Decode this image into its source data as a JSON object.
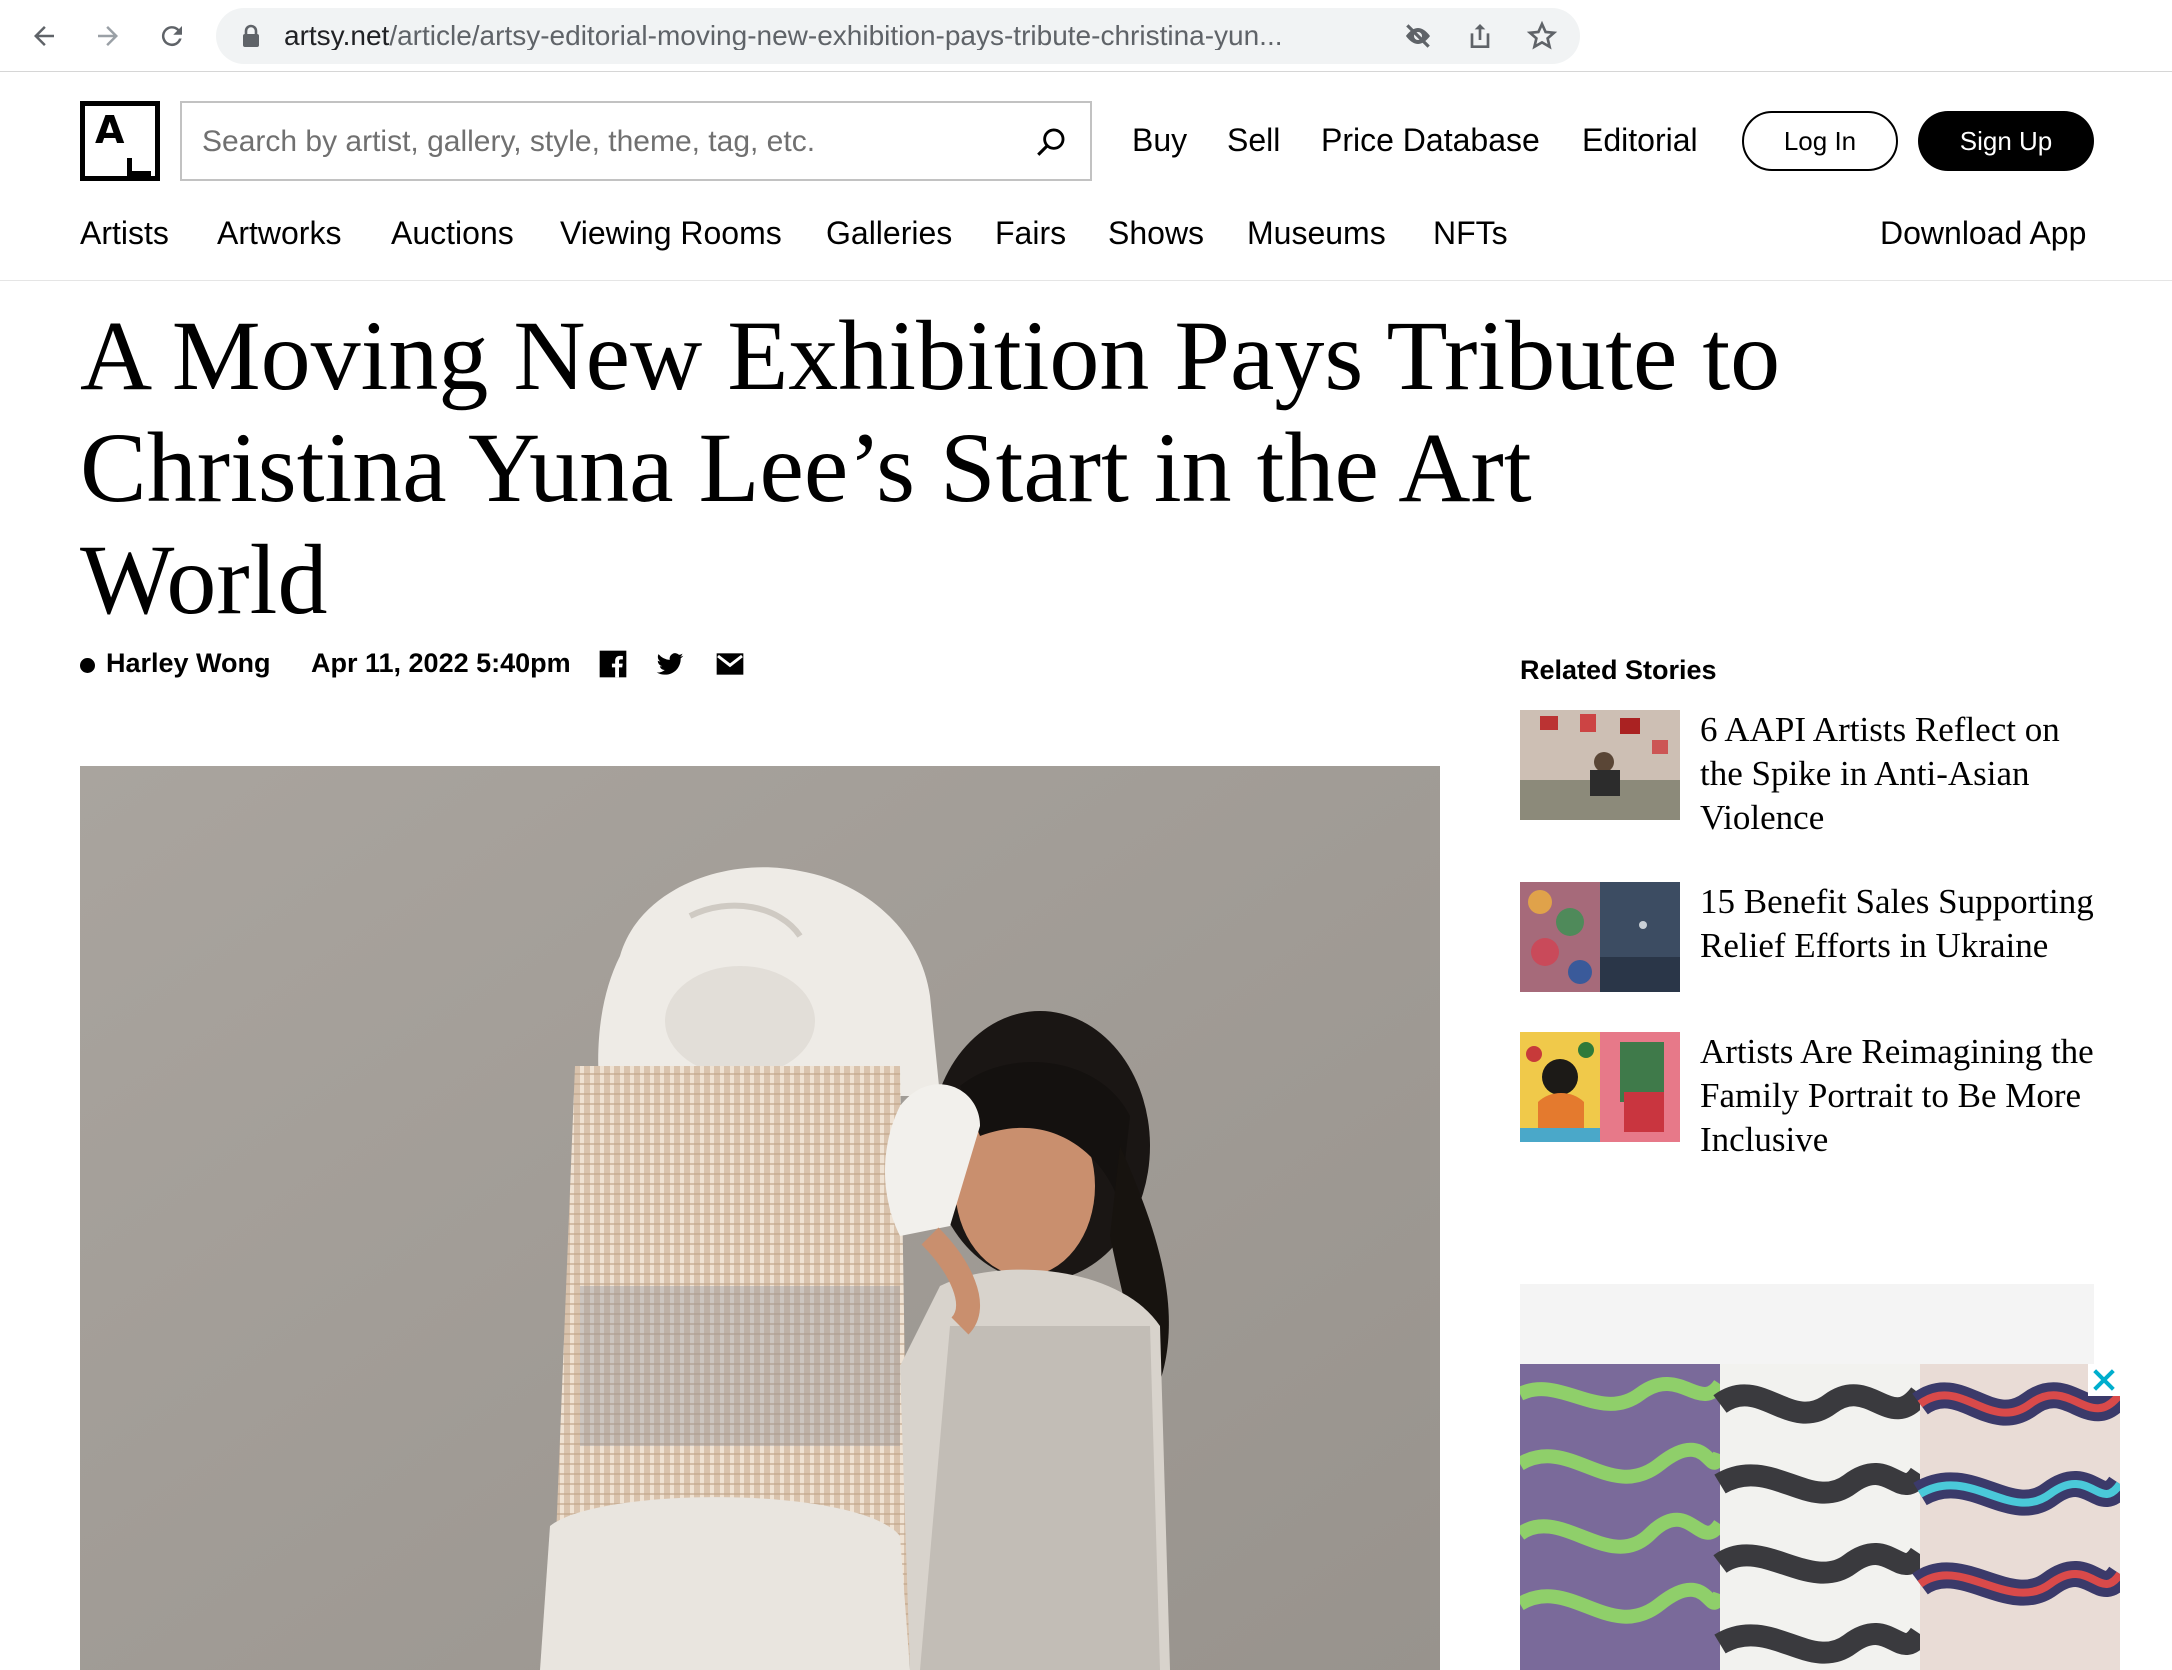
{
  "browser": {
    "url_host": "artsy.net",
    "url_path": "/article/artsy-editorial-moving-new-exhibition-pays-tribute-christina-yun..."
  },
  "header": {
    "logo_letter": "A",
    "search_placeholder": "Search by artist, gallery, style, theme, tag, etc.",
    "nav": [
      "Buy",
      "Sell",
      "Price Database",
      "Editorial"
    ],
    "login_label": "Log In",
    "signup_label": "Sign Up",
    "subnav": [
      "Artists",
      "Artworks",
      "Auctions",
      "Viewing Rooms",
      "Galleries",
      "Fairs",
      "Shows",
      "Museums",
      "NFTs"
    ],
    "download_app": "Download App"
  },
  "article": {
    "headline_line1": "A Moving New Exhibition Pays Tribute to",
    "headline_line2": "Christina Yuna Lee’s Start in the Art World",
    "author": "Harley Wong",
    "date": "Apr 11, 2022 5:40pm"
  },
  "sidebar": {
    "title": "Related Stories",
    "stories": [
      {
        "title": "6 AAPI Artists Reflect on the Spike in Anti-Asian Violence"
      },
      {
        "title": "15 Benefit Sales Supporting Relief Efforts in Ukraine"
      },
      {
        "title": "Artists Are Reimagining the Family Portrait to Be More Inclusive"
      }
    ]
  },
  "ad": {
    "close_glyph": "✕"
  },
  "colors": {
    "accent": "#000000",
    "chrome_bg": "#f1f3f4",
    "ad_bg": "#f4f4f4"
  }
}
